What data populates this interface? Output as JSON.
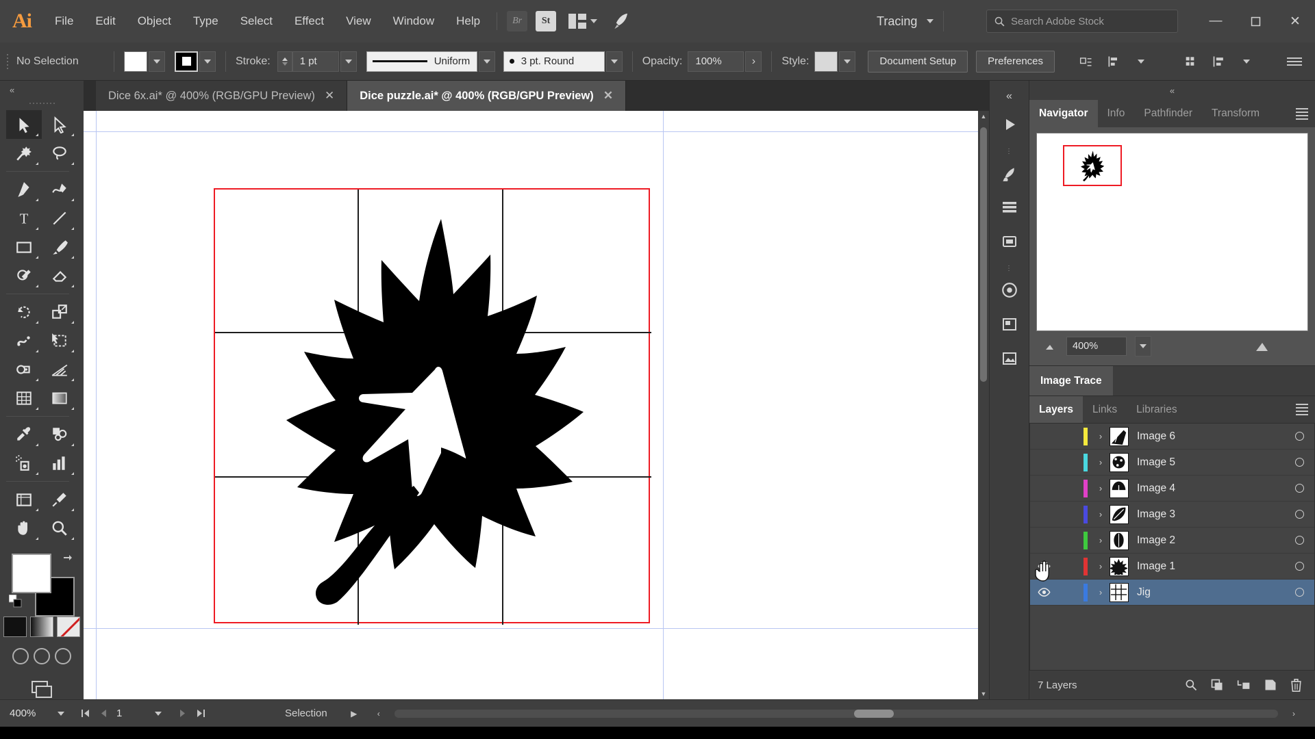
{
  "app": {
    "logo": "Ai",
    "name": "Adobe Illustrator"
  },
  "menu": {
    "items": [
      "File",
      "Edit",
      "Object",
      "Type",
      "Select",
      "Effect",
      "View",
      "Window",
      "Help"
    ],
    "bridge_icon": "Br",
    "stock_icon": "St",
    "arrange_icon": "arrange-documents-icon",
    "rocket_icon": "discover-rocket-icon",
    "workspace": {
      "label": "Tracing",
      "chevron": "chevron-down-icon"
    },
    "search": {
      "placeholder": "Search Adobe Stock",
      "icon": "search-icon"
    },
    "window_controls": {
      "minimize": "—",
      "maximize": "❐",
      "close": "✕"
    }
  },
  "control_bar": {
    "selection_status": "No Selection",
    "fill_swatch": "#ffffff",
    "stroke_swatch": "#000000",
    "stroke_label": "Stroke:",
    "stroke_weight": "1 pt",
    "stroke_profile": "Uniform",
    "brush_definition": "3 pt. Round",
    "opacity_label": "Opacity:",
    "opacity_value": "100%",
    "opacity_arrow": "›",
    "style_label": "Style:",
    "style_swatch": "#d9d9d9",
    "document_setup": "Document Setup",
    "preferences": "Preferences",
    "align_icon": "align-objects-icon",
    "distribute_icon": "distribute-icon",
    "grid_icon": "grid-view-icon",
    "transform_icon": "transform-icon",
    "options_icon": "panel-options-icon"
  },
  "tabs": [
    {
      "label": "Dice 6x.ai* @ 400% (RGB/GPU Preview)",
      "active": false,
      "close": "✕"
    },
    {
      "label": "Dice puzzle.ai* @ 400% (RGB/GPU Preview)",
      "active": true,
      "close": "✕"
    }
  ],
  "toolbar": {
    "tools": [
      {
        "name": "selection-tool",
        "active": true
      },
      {
        "name": "direct-selection-tool",
        "active": false
      },
      {
        "name": "magic-wand-tool",
        "active": false
      },
      {
        "name": "lasso-tool",
        "active": false
      },
      {
        "name": "pen-tool",
        "active": false
      },
      {
        "name": "curvature-tool",
        "active": false
      },
      {
        "name": "type-tool",
        "active": false
      },
      {
        "name": "line-segment-tool",
        "active": false
      },
      {
        "name": "rectangle-tool",
        "active": false
      },
      {
        "name": "paintbrush-tool",
        "active": false
      },
      {
        "name": "shaper-tool",
        "active": false
      },
      {
        "name": "eraser-tool",
        "active": false
      },
      {
        "name": "rotate-tool",
        "active": false
      },
      {
        "name": "scale-tool",
        "active": false
      },
      {
        "name": "width-tool",
        "active": false
      },
      {
        "name": "free-transform-tool",
        "active": false
      },
      {
        "name": "shape-builder-tool",
        "active": false
      },
      {
        "name": "perspective-grid-tool",
        "active": false
      },
      {
        "name": "mesh-tool",
        "active": false
      },
      {
        "name": "gradient-tool",
        "active": false
      },
      {
        "name": "eyedropper-tool",
        "active": false
      },
      {
        "name": "blend-tool",
        "active": false
      },
      {
        "name": "symbol-sprayer-tool",
        "active": false
      },
      {
        "name": "column-graph-tool",
        "active": false
      },
      {
        "name": "artboard-tool",
        "active": false
      },
      {
        "name": "slice-tool",
        "active": false
      },
      {
        "name": "hand-tool",
        "active": false
      },
      {
        "name": "zoom-tool",
        "active": false
      }
    ],
    "fill_color": "#ffffff",
    "stroke_color": "#000000",
    "paint_modes": [
      "color-mode",
      "gradient-mode",
      "none-mode"
    ],
    "draw_modes": [
      "draw-normal",
      "draw-behind",
      "draw-inside"
    ],
    "screen_mode": "change-screen-mode"
  },
  "canvas": {
    "artwork": "maple-leaf-silhouette",
    "artboard_border_color": "#ee1b24",
    "guide_color": "#b9c6f2",
    "grid_color": "#1d1d1d",
    "background": "#ffffff"
  },
  "dock": {
    "icons": [
      "start-playback-icon",
      "brushes-icon",
      "swatches-icon",
      "symbols-icon",
      "appearance-icon",
      "artboards-icon",
      "image-trace-icon"
    ]
  },
  "right_panel": {
    "collapse": "«",
    "top_tabs": [
      {
        "label": "Navigator",
        "active": true
      },
      {
        "label": "Info",
        "active": false
      },
      {
        "label": "Pathfinder",
        "active": false
      },
      {
        "label": "Transform",
        "active": false
      }
    ],
    "panel_menu_icon": "panel-menu-icon",
    "navigator": {
      "zoom_value": "400%",
      "zoom_out_icon": "zoom-out-small-icon",
      "zoom_in_icon": "zoom-in-large-icon",
      "chevron": "chevron-down-icon",
      "view_box_color": "#ee1b24"
    },
    "image_trace_tab": "Image Trace",
    "bottom_tabs": [
      {
        "label": "Layers",
        "active": true
      },
      {
        "label": "Links",
        "active": false
      },
      {
        "label": "Libraries",
        "active": false
      }
    ],
    "layers": [
      {
        "name": "Image 6",
        "color": "#f5e93c",
        "visible": false,
        "selected": false,
        "thumb": "leaf-thumb-6",
        "disclosure": "›",
        "target": "target-circle"
      },
      {
        "name": "Image 5",
        "color": "#4ad8e0",
        "visible": false,
        "selected": false,
        "thumb": "leaf-thumb-5",
        "disclosure": "›",
        "target": "target-circle"
      },
      {
        "name": "Image 4",
        "color": "#e040c8",
        "visible": false,
        "selected": false,
        "thumb": "leaf-thumb-4",
        "disclosure": "›",
        "target": "target-circle"
      },
      {
        "name": "Image 3",
        "color": "#4a4ae0",
        "visible": false,
        "selected": false,
        "thumb": "leaf-thumb-3",
        "disclosure": "›",
        "target": "target-circle"
      },
      {
        "name": "Image 2",
        "color": "#3ec93e",
        "visible": false,
        "selected": false,
        "thumb": "leaf-thumb-2",
        "disclosure": "›",
        "target": "target-circle"
      },
      {
        "name": "Image 1",
        "color": "#e03434",
        "visible": true,
        "selected": false,
        "thumb": "leaf-thumb-1",
        "disclosure": "›",
        "target": "target-circle"
      },
      {
        "name": "Jig",
        "color": "#3a7ae0",
        "visible": true,
        "selected": true,
        "thumb": "grid-thumb",
        "disclosure": "›",
        "target": "target-circle"
      }
    ],
    "layer_count": "7 Layers",
    "footer_icons": [
      "locate-object-icon",
      "create-new-sublayer-icon",
      "make-clipping-mask-icon",
      "create-new-layer-icon",
      "delete-selection-icon"
    ]
  },
  "status_bar": {
    "zoom": "400%",
    "zoom_chevron": "chevron-down-icon",
    "first_page_icon": "⏮",
    "prev_page_icon": "◀",
    "page": "1",
    "page_chevron": "chevron-down-icon",
    "next_page_icon": "▶",
    "last_page_icon": "⏭",
    "current_tool": "Selection",
    "play_icon": "▶",
    "scroll_left_icon": "‹",
    "scroll_right_icon": "›"
  }
}
